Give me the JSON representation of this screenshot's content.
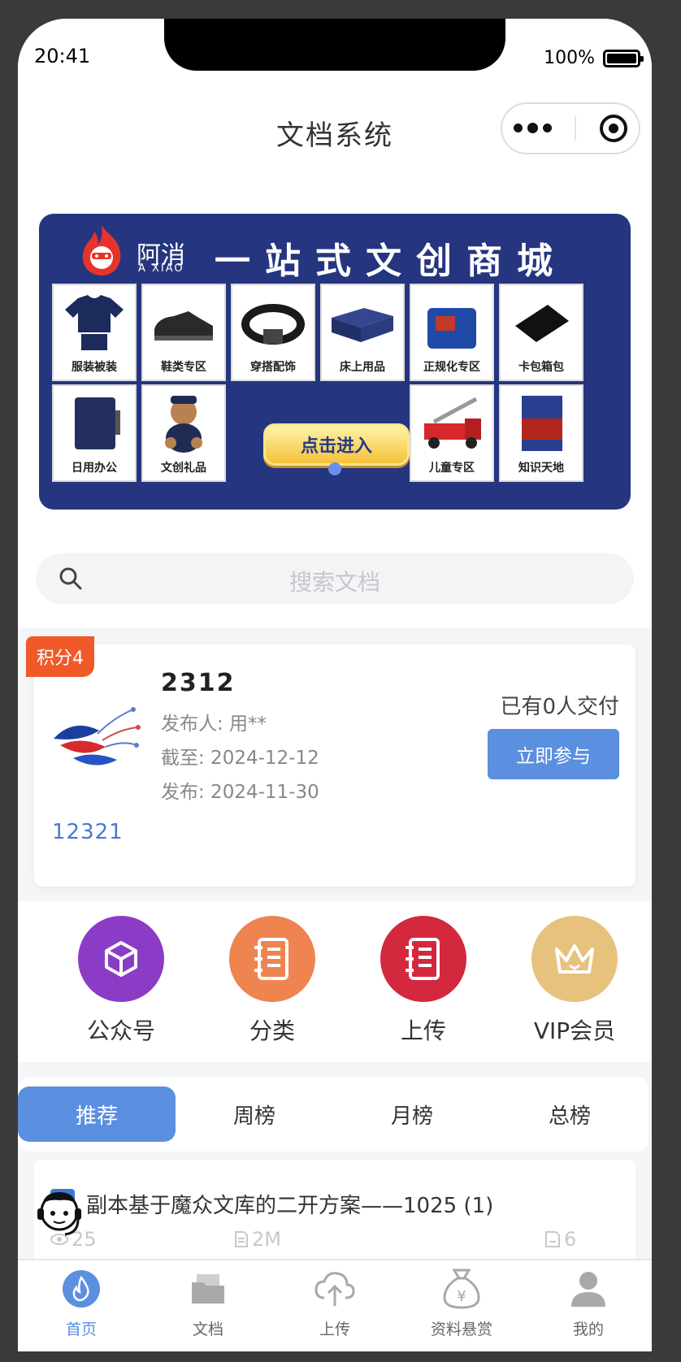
{
  "status_bar": {
    "time": "20:41",
    "battery": "100%"
  },
  "nav": {
    "title": "文档系统"
  },
  "banner": {
    "brand_cn": "阿消",
    "brand_en": "A XIAO",
    "headline": "一站式文创商城",
    "tiles": [
      "服装被装",
      "鞋类专区",
      "穿搭配饰",
      "床上用品",
      "正规化专区",
      "卡包箱包",
      "日用办公",
      "文创礼品",
      "儿童专区",
      "知识天地"
    ],
    "enter_label": "点击进入"
  },
  "search": {
    "placeholder": "搜索文档"
  },
  "bounty": {
    "points_badge": "积分4",
    "title": "2312",
    "publisher": "发布人: 用**",
    "deadline": "截至: 2024-12-12",
    "published": "发布: 2024-11-30",
    "paid_count": "已有0人交付",
    "join_label": "立即参与",
    "code": "12321"
  },
  "quick_actions": [
    {
      "label": "公众号",
      "icon": "cube-icon",
      "color": "#8a3cc6"
    },
    {
      "label": "分类",
      "icon": "notebook-icon",
      "color": "#ee8450"
    },
    {
      "label": "上传",
      "icon": "notebook-icon",
      "color": "#d3283d"
    },
    {
      "label": "VIP会员",
      "icon": "crown-icon",
      "color": "#e6c27c"
    }
  ],
  "ranking_tabs": [
    "推荐",
    "周榜",
    "月榜",
    "总榜"
  ],
  "documents": [
    {
      "title": "副本基于魔众文库的二开方案——1025 (1)",
      "views": "25",
      "size": "2M",
      "pages": "6"
    }
  ],
  "tabbar": [
    {
      "label": "首页",
      "icon": "home-flame-icon",
      "active": true
    },
    {
      "label": "文档",
      "icon": "folder-icon",
      "active": false
    },
    {
      "label": "上传",
      "icon": "cloud-upload-icon",
      "active": false
    },
    {
      "label": "资料悬赏",
      "icon": "money-bag-icon",
      "active": false
    },
    {
      "label": "我的",
      "icon": "user-icon",
      "active": false
    }
  ],
  "colors": {
    "accent": "#5b8fdf",
    "badge": "#ef5a28",
    "banner_bg": "#26357f"
  }
}
